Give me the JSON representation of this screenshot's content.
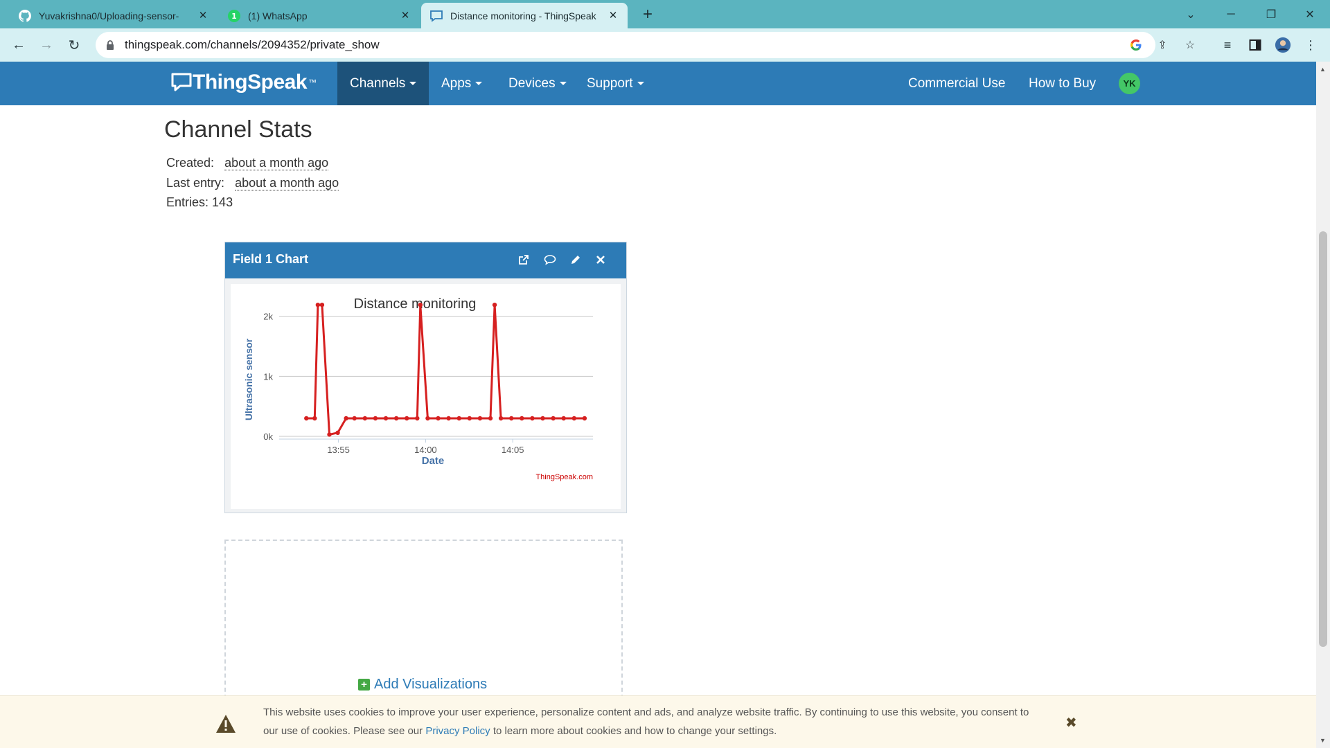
{
  "browser": {
    "tabs": [
      {
        "title": "Yuvakrishna0/Uploading-sensor-",
        "icon": "github-icon"
      },
      {
        "title": "(1) WhatsApp",
        "icon": "whatsapp-icon"
      },
      {
        "title": "Distance monitoring - ThingSpeak",
        "icon": "thingspeak-icon",
        "active": true
      }
    ],
    "url": "thingspeak.com/channels/2094352/private_show"
  },
  "nav": {
    "logo_text": "ThingSpeak",
    "logo_tm": "™",
    "items": [
      "Channels",
      "Apps",
      "Devices",
      "Support"
    ],
    "right_items": [
      "Commercial Use",
      "How to Buy"
    ],
    "avatar_initials": "YK"
  },
  "stats": {
    "title": "Channel Stats",
    "created_label": "Created:",
    "created_value": "about a month ago",
    "last_entry_label": "Last entry:",
    "last_entry_value": "about a month ago",
    "entries_label": "Entries:",
    "entries_value": "143"
  },
  "chart_card": {
    "title": "Field 1 Chart",
    "icons": [
      "external-link-icon",
      "comment-icon",
      "pencil-icon",
      "close-icon"
    ]
  },
  "chart_data": {
    "type": "line",
    "title": "Distance monitoring",
    "xlabel": "Date",
    "ylabel": "Ultrasonic sensor",
    "credit": "ThingSpeak.com",
    "series_color": "#d62020",
    "x_ticks": [
      "13:55",
      "14:00",
      "14:05"
    ],
    "y_ticks": [
      "0k",
      "1k",
      "2k"
    ],
    "xlim": [
      13.86,
      14.16
    ],
    "ylim": [
      0,
      2100
    ],
    "x": [
      13.886,
      13.894,
      13.901,
      13.908,
      13.916,
      13.924,
      13.932,
      13.942,
      13.952,
      13.962,
      13.972,
      13.982,
      13.992,
      14.002,
      14.012,
      14.022,
      14.032,
      14.042,
      14.052,
      14.062,
      14.072,
      14.082,
      14.092,
      14.102,
      14.112,
      14.122,
      14.132,
      14.142,
      14.152
    ],
    "values": [
      300,
      300,
      2190,
      30,
      60,
      300,
      300,
      300,
      300,
      300,
      300,
      300,
      300,
      300,
      300,
      300,
      300,
      300,
      300,
      300,
      300,
      300,
      300,
      300,
      300,
      300,
      300,
      300,
      300
    ],
    "spikes": [
      {
        "x": 13.897,
        "y": 2190
      },
      {
        "x": 13.995,
        "y": 2190
      },
      {
        "x": 14.066,
        "y": 2190
      }
    ]
  },
  "viz": {
    "add_label": "Add Visualizations"
  },
  "cookie": {
    "line1": "This website uses cookies to improve your user experience, personalize content and ads, and analyze website traffic. By continuing to use this website, you consent to",
    "line2_pre": "our use of cookies. Please see our ",
    "link": "Privacy Policy",
    "line2_post": " to learn more about cookies and how to change your settings."
  }
}
